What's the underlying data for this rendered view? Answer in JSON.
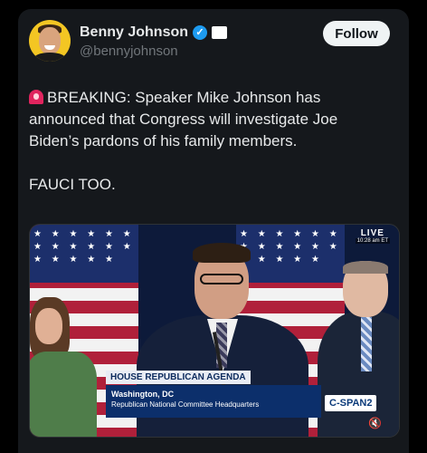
{
  "author": {
    "name": "Benny Johnson",
    "handle": "@bennyjohnson",
    "verified_icon": "verified-badge-icon",
    "affiliate_icon": "affiliate-badge-icon"
  },
  "follow_label": "Follow",
  "tweet": {
    "line1": "BREAKING: Speaker Mike Johnson has announced that Congress will investigate Joe Biden’s pardons of his family members.",
    "line2": "FAUCI TOO.",
    "emoji_icon": "siren-icon"
  },
  "video": {
    "live": "LIVE",
    "live_time": "10:28 am ET",
    "chyron_title": "HOUSE REPUBLICAN AGENDA",
    "chyron_location": "Washington, DC",
    "chyron_place": "Republican National Committee Headquarters",
    "network": "C-SPAN2",
    "mute_icon": "speaker-muted-icon"
  },
  "colors": {
    "background": "#000000",
    "card": "#15181c",
    "verified": "#1d9bf0",
    "follow_bg": "#eff3f4"
  }
}
